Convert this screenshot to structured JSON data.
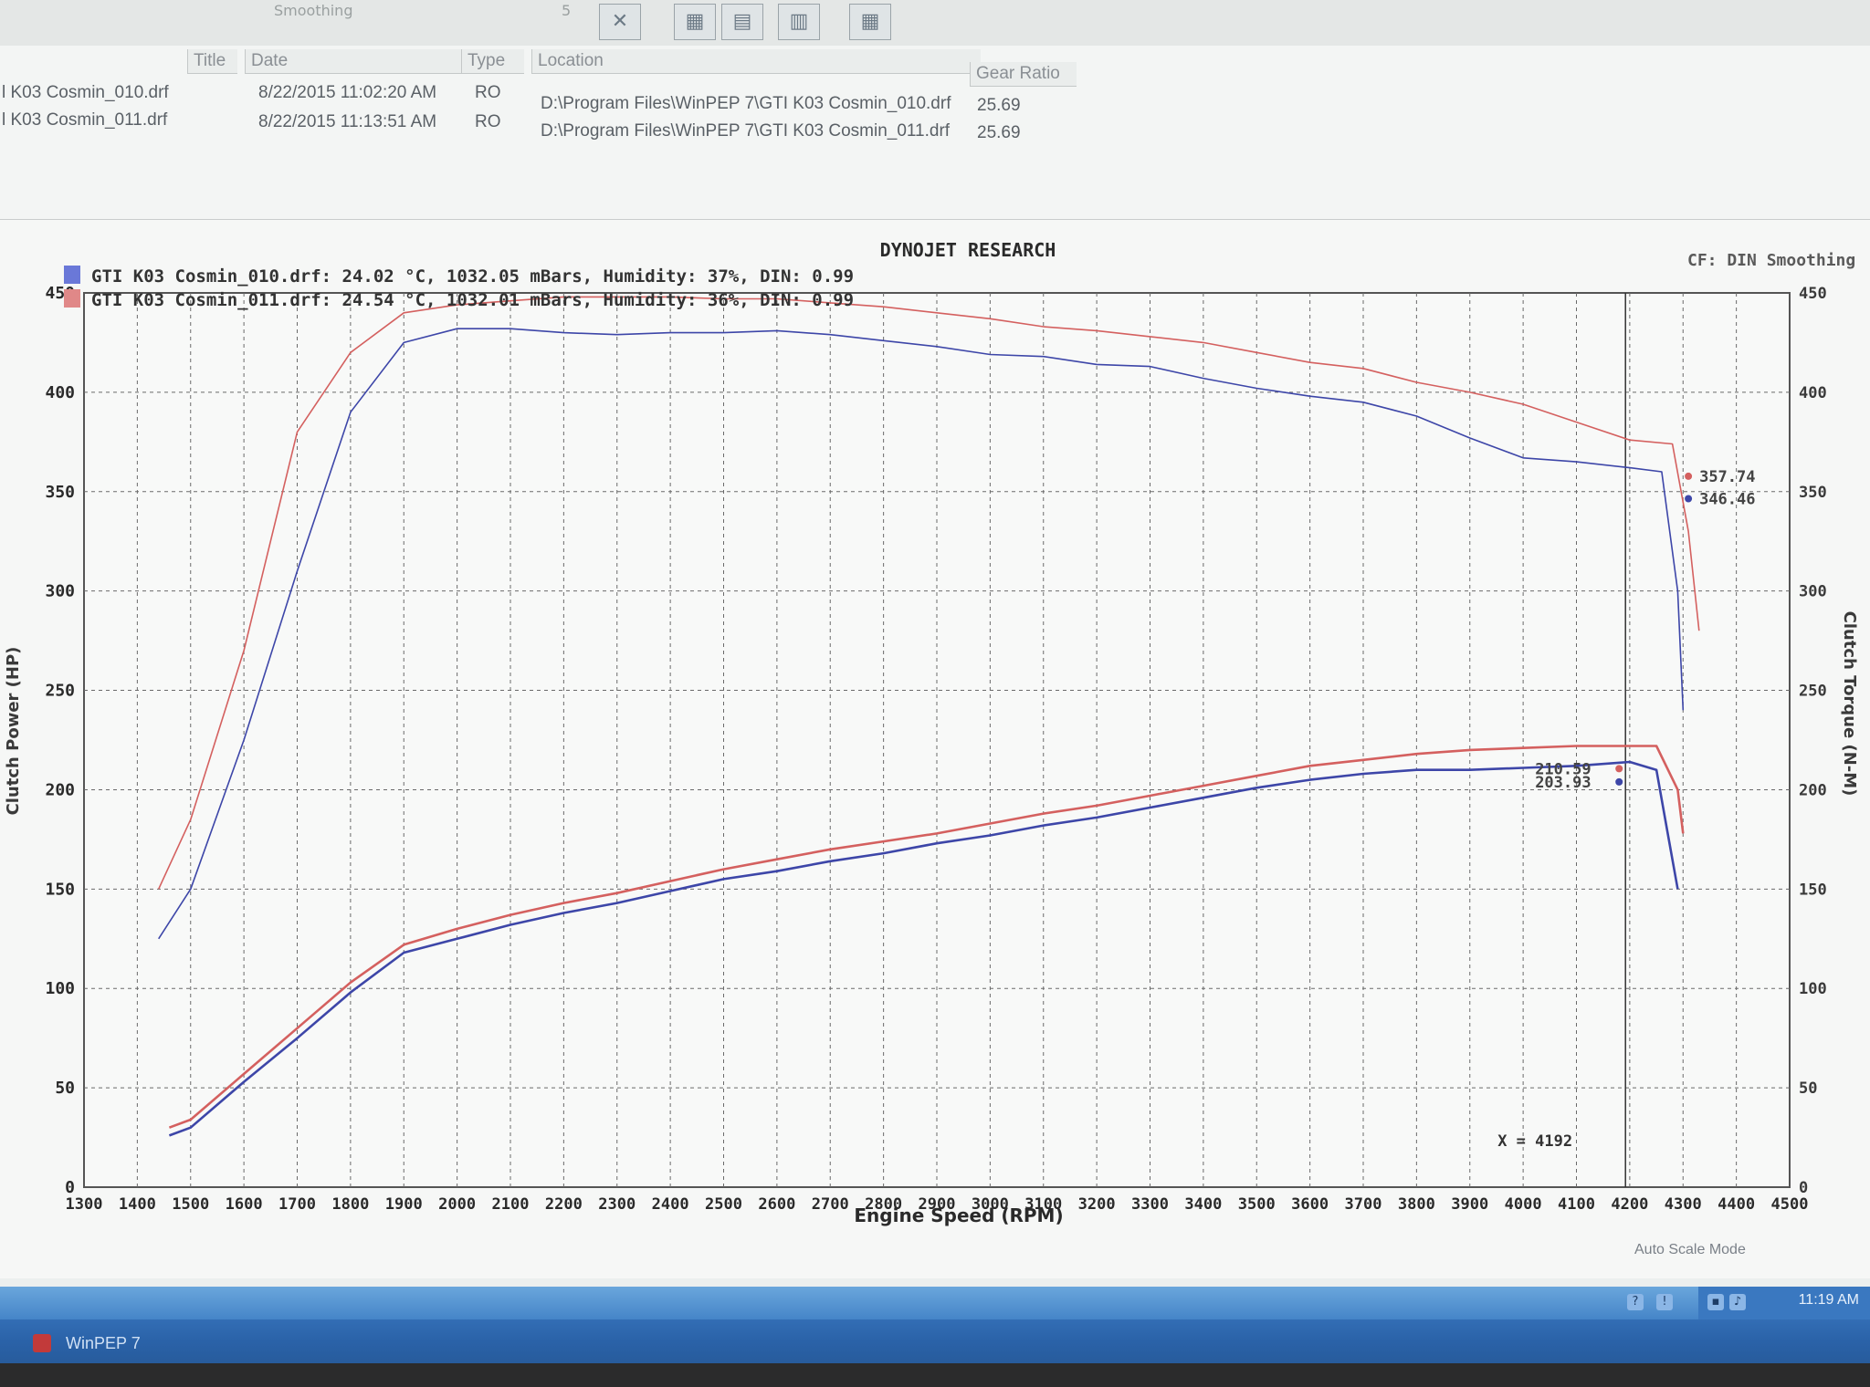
{
  "toolbar": {
    "smoothing_label": "Smoothing",
    "smoothing_value": "5"
  },
  "file_list": {
    "columns": [
      "Title",
      "Date",
      "Type",
      "Location",
      "Gear Ratio"
    ],
    "rows": [
      {
        "title": "l K03 Cosmin_010.drf",
        "date": "8/22/2015 11:02:20 AM",
        "type": "RO",
        "location": "D:\\Program Files\\WinPEP 7\\GTI K03 Cosmin_010.drf",
        "gear_ratio": "25.69"
      },
      {
        "title": "l K03 Cosmin_011.drf",
        "date": "8/22/2015 11:13:51 AM",
        "type": "RO",
        "location": "D:\\Program Files\\WinPEP 7\\GTI K03 Cosmin_011.drf",
        "gear_ratio": "25.69"
      }
    ]
  },
  "chart_window": {
    "status": "Auto Scale Mode"
  },
  "taskbar": {
    "app_label": "WinPEP 7",
    "clock": "11:19 AM"
  },
  "colors": {
    "run_010": "#3d46a8",
    "run_011": "#d4605f",
    "grid": "#6a6a6a"
  },
  "chart_data": {
    "type": "line",
    "title": "DYNOJET RESEARCH",
    "corner_label": "CF: DIN  Smoothing",
    "xlabel": "Engine Speed (RPM)",
    "ylabel_left": "Clutch Power (HP)",
    "ylabel_right": "Clutch Torque (N-M)",
    "xlim": [
      1300,
      4500
    ],
    "x_ticks": [
      1300,
      1400,
      1500,
      1600,
      1700,
      1800,
      1900,
      2000,
      2100,
      2200,
      2300,
      2400,
      2500,
      2600,
      2700,
      2800,
      2900,
      3000,
      3100,
      3200,
      3300,
      3400,
      3500,
      3600,
      3700,
      3800,
      3900,
      4000,
      4100,
      4200,
      4300,
      4400,
      4500
    ],
    "ylim_left": [
      0,
      450
    ],
    "y_ticks_left": [
      0,
      50,
      100,
      150,
      200,
      250,
      300,
      350,
      400,
      450
    ],
    "ylim_right": [
      0,
      450
    ],
    "y_ticks_right": [
      0,
      50,
      100,
      150,
      200,
      250,
      300,
      350,
      400,
      450
    ],
    "legend": [
      "GTI K03 Cosmin_010.drf: 24.02 °C, 1032.05 mBars, Humidity: 37%, DIN: 0.99",
      "GTI K03 Cosmin_011.drf: 24.54 °C, 1032.01 mBars, Humidity: 36%, DIN: 0.99"
    ],
    "cursor": {
      "label": "X = 4192",
      "x": 4192
    },
    "series": [
      {
        "name": "GTI K03 Cosmin_010.drf",
        "axis": "power",
        "color": "#3d46a8",
        "x": [
          1460,
          1500,
          1600,
          1700,
          1800,
          1900,
          2000,
          2100,
          2200,
          2300,
          2400,
          2500,
          2600,
          2700,
          2800,
          2900,
          3000,
          3100,
          3200,
          3300,
          3400,
          3500,
          3600,
          3700,
          3800,
          3900,
          4000,
          4100,
          4200,
          4250,
          4270,
          4290
        ],
        "y": [
          26,
          30,
          53,
          75,
          98,
          118,
          125,
          132,
          138,
          143,
          149,
          155,
          159,
          164,
          168,
          173,
          177,
          182,
          186,
          191,
          196,
          201,
          205,
          208,
          210,
          210,
          211,
          212,
          214,
          210,
          180,
          150
        ],
        "end_label": "203.93",
        "end_x": 4180
      },
      {
        "name": "GTI K03 Cosmin_011.drf",
        "axis": "power",
        "color": "#d4605f",
        "x": [
          1460,
          1500,
          1600,
          1700,
          1800,
          1900,
          2000,
          2100,
          2200,
          2300,
          2400,
          2500,
          2600,
          2700,
          2800,
          2900,
          3000,
          3100,
          3200,
          3300,
          3400,
          3500,
          3600,
          3700,
          3800,
          3900,
          4000,
          4100,
          4200,
          4250,
          4290,
          4300
        ],
        "y": [
          30,
          34,
          57,
          80,
          103,
          122,
          130,
          137,
          143,
          148,
          154,
          160,
          165,
          170,
          174,
          178,
          183,
          188,
          192,
          197,
          202,
          207,
          212,
          215,
          218,
          220,
          221,
          222,
          222,
          222,
          200,
          178
        ],
        "end_label": "210.59",
        "end_x": 4180
      },
      {
        "name": "GTI K03 Cosmin_010.drf",
        "axis": "torque",
        "color": "#3d46a8",
        "x": [
          1440,
          1500,
          1600,
          1700,
          1800,
          1900,
          2000,
          2100,
          2200,
          2300,
          2400,
          2500,
          2600,
          2700,
          2800,
          2900,
          3000,
          3100,
          3200,
          3300,
          3400,
          3500,
          3600,
          3700,
          3800,
          3900,
          4000,
          4100,
          4200,
          4260,
          4290,
          4300
        ],
        "y": [
          125,
          150,
          225,
          310,
          390,
          425,
          432,
          432,
          430,
          429,
          430,
          430,
          431,
          429,
          426,
          423,
          419,
          418,
          414,
          413,
          407,
          402,
          398,
          395,
          388,
          377,
          367,
          365,
          362,
          360,
          300,
          240
        ],
        "end_label": "346.46",
        "end_x": 4310
      },
      {
        "name": "GTI K03 Cosmin_011.drf",
        "axis": "torque",
        "color": "#d4605f",
        "x": [
          1440,
          1500,
          1600,
          1700,
          1800,
          1900,
          2000,
          2100,
          2200,
          2300,
          2400,
          2500,
          2600,
          2700,
          2800,
          2900,
          3000,
          3100,
          3200,
          3300,
          3400,
          3500,
          3600,
          3700,
          3800,
          3900,
          4000,
          4100,
          4200,
          4280,
          4310,
          4330
        ],
        "y": [
          150,
          185,
          270,
          380,
          420,
          440,
          444,
          446,
          448,
          448,
          448,
          447,
          447,
          445,
          443,
          440,
          437,
          433,
          431,
          428,
          425,
          420,
          415,
          412,
          405,
          400,
          394,
          385,
          376,
          374,
          330,
          280
        ],
        "end_label": "357.74",
        "end_x": 4310
      }
    ]
  }
}
